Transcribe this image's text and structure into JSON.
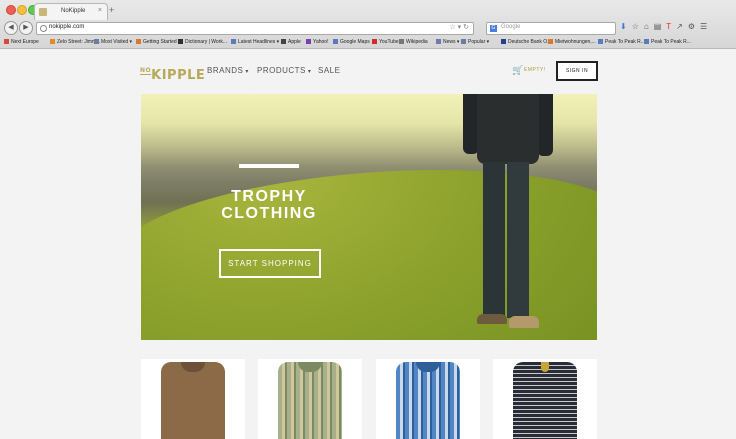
{
  "browser": {
    "tab_title": "NoKipple",
    "tab_close": "×",
    "new_tab": "+",
    "url": "nokipple.com",
    "search_placeholder": "Google",
    "search_engine_letter": "G",
    "bookmarks": [
      {
        "label": "Next Europe",
        "color": "#d44a3a"
      },
      {
        "label": "Zelo Street: Jimm...",
        "color": "#e08a2a"
      },
      {
        "label": "Most Visited ▾",
        "color": "#6c7ca6"
      },
      {
        "label": "Getting Started",
        "color": "#d67a2e"
      },
      {
        "label": "Dictionary | Work...",
        "color": "#2f2f2f"
      },
      {
        "label": "Latest Headlines ▾",
        "color": "#5a7bc0"
      },
      {
        "label": "Apple",
        "color": "#444444"
      },
      {
        "label": "Yahoo!",
        "color": "#7a3fb0"
      },
      {
        "label": "Google Maps",
        "color": "#5a7bc0"
      },
      {
        "label": "YouTube",
        "color": "#d52a2a"
      },
      {
        "label": "Wikipedia",
        "color": "#777777"
      },
      {
        "label": "News ▾",
        "color": "#6c7ca6"
      },
      {
        "label": "Popular ▾",
        "color": "#6c7ca6"
      },
      {
        "label": "Deutsche Bank O...",
        "color": "#2a3f8a"
      },
      {
        "label": "Mietwohnungen,...",
        "color": "#d67a2e"
      },
      {
        "label": "Peak To Peak R...",
        "color": "#5a7bc0"
      },
      {
        "label": "Peak To Peak R...",
        "color": "#5a7bc0"
      }
    ]
  },
  "site": {
    "logo_no": "NO",
    "logo_kipple": "KIPPLE",
    "nav": [
      {
        "label": "BRANDS",
        "chevron": "▾"
      },
      {
        "label": "PRODUCTS",
        "chevron": "▾"
      },
      {
        "label": "SALE",
        "chevron": ""
      }
    ],
    "cart_icon": "🛒",
    "cart_status": "EMPTY!",
    "sign_in": "SIGN IN"
  },
  "hero": {
    "title_line1": "TROPHY",
    "title_line2": "CLOTHING",
    "cta": "START SHOPPING"
  },
  "products": [
    {
      "name": "brown-shirt"
    },
    {
      "name": "green-plaid-shirt"
    },
    {
      "name": "blue-plaid-shirt"
    },
    {
      "name": "striped-sweater"
    }
  ]
}
